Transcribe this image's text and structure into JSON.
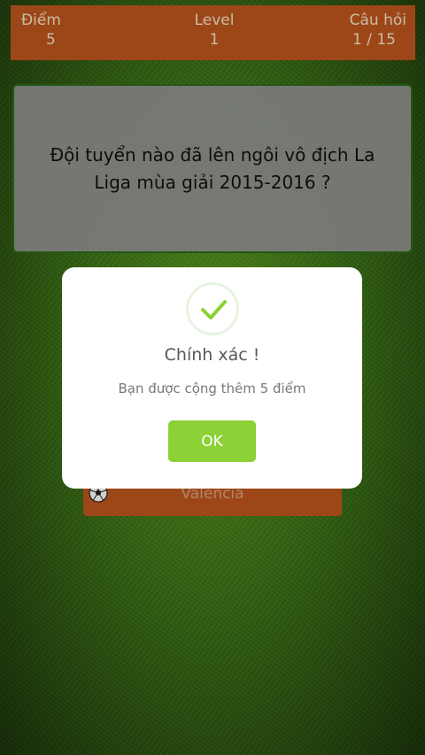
{
  "header": {
    "score_label": "Điểm",
    "score_value": "5",
    "level_label": "Level",
    "level_value": "1",
    "question_label": "Câu hỏi",
    "question_value": "1 / 15"
  },
  "question": {
    "text": "Đội tuyển nào đã lên ngôi vô địch La Liga mùa giải 2015-2016 ?"
  },
  "answers": [
    {
      "label": "Valencia",
      "icon": "soccer-ball-icon"
    }
  ],
  "dialog": {
    "icon": "checkmark-icon",
    "title": "Chính xác !",
    "message": "Bạn được cộng thêm 5 điểm",
    "ok_label": "OK"
  },
  "colors": {
    "header_bg": "#c0571f",
    "ok_button": "#8cd135",
    "check": "#8cd135"
  }
}
